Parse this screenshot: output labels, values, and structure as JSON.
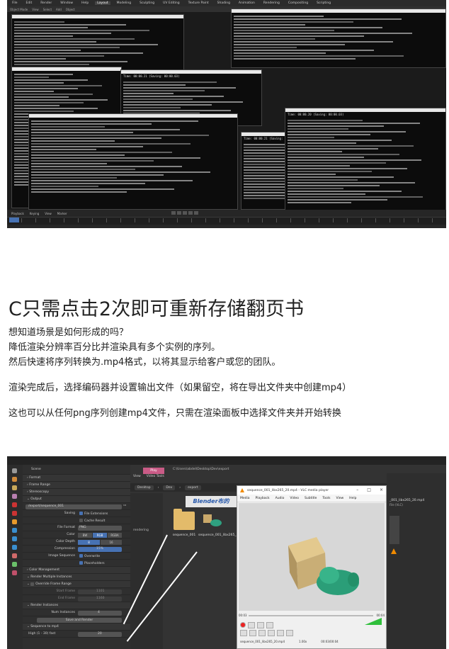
{
  "top_screenshot": {
    "menu_items": [
      "File",
      "Edit",
      "Render",
      "Window",
      "Help"
    ],
    "tabs": [
      "Layout",
      "Modeling",
      "Sculpting",
      "UV Editing",
      "Texture Paint",
      "Shading",
      "Animation",
      "Rendering",
      "Compositing",
      "Scripting"
    ],
    "active_tab": "Layout",
    "toolbar_items": [
      "Object Mode",
      "View",
      "Select",
      "Add",
      "Object"
    ],
    "terminal_titles": [
      "Time: 00:00.21 (Saving: 00:00.03)",
      "Time: 00:00.20 (Saving: 00:00.03)",
      "Time: 00:00.21 (Saving: 00:00.03)"
    ],
    "timeline": {
      "controls": [
        "Playback",
        "Keying",
        "View",
        "Marker"
      ],
      "current_frame": "1"
    }
  },
  "article": {
    "heading": "C只需点击2次即可重新存储翻页书",
    "lines": [
      "想知道场景是如何形成的吗？",
      "降低渲染分辨率百分比并渲染具有多个实例的序列。",
      "然后快速将序列转换为.mp4格式，以将其显示给客户或您的团队。",
      "渲染完成后，选择编码器并设置输出文件（如果留空，将在导出文件夹中创建mp4）",
      "这也可以从任何png序列创建mp4文件，只需在渲染面板中选择文件夹并开始转换"
    ]
  },
  "bottom_screenshot": {
    "properties": {
      "scene_label": "Scene",
      "sections": {
        "format": "Format",
        "frame_range": "Frame Range",
        "stereoscopy": "Stereoscopy",
        "output": "Output",
        "color_management": "Color Management",
        "render_multiple": "Render Multiple Instances",
        "override_frame_range": "Override Frame Range",
        "render_instances": "Render Instances",
        "sequence_to_mp4": "Sequence to mp4"
      },
      "output_path": "/export/sequence_001",
      "saving_label": "Saving",
      "file_extensions": "File Extensions",
      "cache_result": "Cache Result",
      "file_format_label": "File Format",
      "file_format_value": "PNG",
      "color_label": "Color",
      "color_options": [
        "BW",
        "RGB",
        "RGBA"
      ],
      "color_depth_label": "Color Depth",
      "color_depth_options": [
        "8",
        "16"
      ],
      "compression_label": "Compression",
      "compression_value": "15%",
      "image_sequence_label": "Image Sequence",
      "overwrite": "Overwrite",
      "placeholders": "Placeholders",
      "start_frame_label": "Start Frame",
      "start_frame_value": "1101",
      "end_frame_label": "End Frame",
      "end_frame_value": "1160",
      "num_instances_label": "Num Instances",
      "num_instances_value": "4",
      "save_render_button": "Save and Render",
      "quality_label": "High (1 - 30) fast",
      "quality_value": "20"
    },
    "file_browser": {
      "play_button": "Play",
      "window_path": "C:\\Users\\abdel\\Desktop\\Dev\\export",
      "tabs": [
        "View",
        "Video Tools"
      ],
      "breadcrumbs": [
        "Desktop",
        "Dev",
        "export"
      ],
      "search_placeholder": "Search export",
      "sidebar_item": "rendering",
      "files": [
        {
          "name": "sequence_001"
        },
        {
          "name": "sequence_001_libx265_20.mp4"
        }
      ],
      "banner": "Blender布的",
      "detail_filename": "_001_libx265_20.mp4",
      "detail_meta": "File (VLC)"
    },
    "vlc": {
      "title": "sequence_001_libx265_20.mp4 - VLC media player",
      "menu": [
        "Media",
        "Playback",
        "Audio",
        "Video",
        "Subtitle",
        "Tools",
        "View",
        "Help"
      ],
      "time_current": "00:03",
      "time_total": "00:04",
      "status_file": "sequence_001_libx265_20.mp4",
      "status_speed": "1.00x",
      "status_time": "00:03/00:04",
      "accent": "#f08a00"
    },
    "colors": {
      "play_button": "#c95b86",
      "selection": "#4772b3",
      "folder": "#e3bb6a"
    }
  }
}
